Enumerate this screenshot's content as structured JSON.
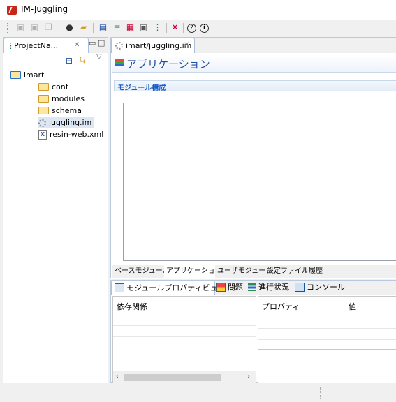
{
  "window": {
    "title": "IM-Juggling"
  },
  "toolbar": {
    "icons": [
      "save-icon",
      "save-as-icon",
      "save-all-icon",
      "run-icon",
      "open-folder-icon",
      "module-icon",
      "add-module-icon",
      "image-icon",
      "picture-icon",
      "tree-icon",
      "tools-icon",
      "help-icon",
      "info-icon"
    ],
    "help_glyph": "?",
    "info_glyph": "i"
  },
  "project_view": {
    "tab_label": "ProjectNa...",
    "tree": {
      "root": "imart",
      "children": [
        "conf",
        "modules",
        "schema",
        "juggling.im",
        "resin-web.xml"
      ]
    }
  },
  "editor": {
    "tab_label": "imart/juggling.im",
    "header_title": "アプリケーション",
    "section_title": "モジュール構成",
    "bottom_tabs": [
      "ベースモジュール",
      "アプリケーション",
      "ユーザモジュール",
      "設定ファイル",
      "履歴"
    ],
    "active_bottom_tab": "アプリケーション"
  },
  "bottom_views": {
    "tabs": [
      "モジュールプロパティビュー",
      "問題",
      "進行状況",
      "コンソール"
    ],
    "left_table_header": "依存関係",
    "right_table_headers": [
      "プロパティ",
      "値"
    ]
  },
  "colors": {
    "accent_blue": "#1f4ea1",
    "section_blue": "#1a5dc6",
    "border": "#b9c9dd",
    "app_icon_red": "#c8261b"
  }
}
